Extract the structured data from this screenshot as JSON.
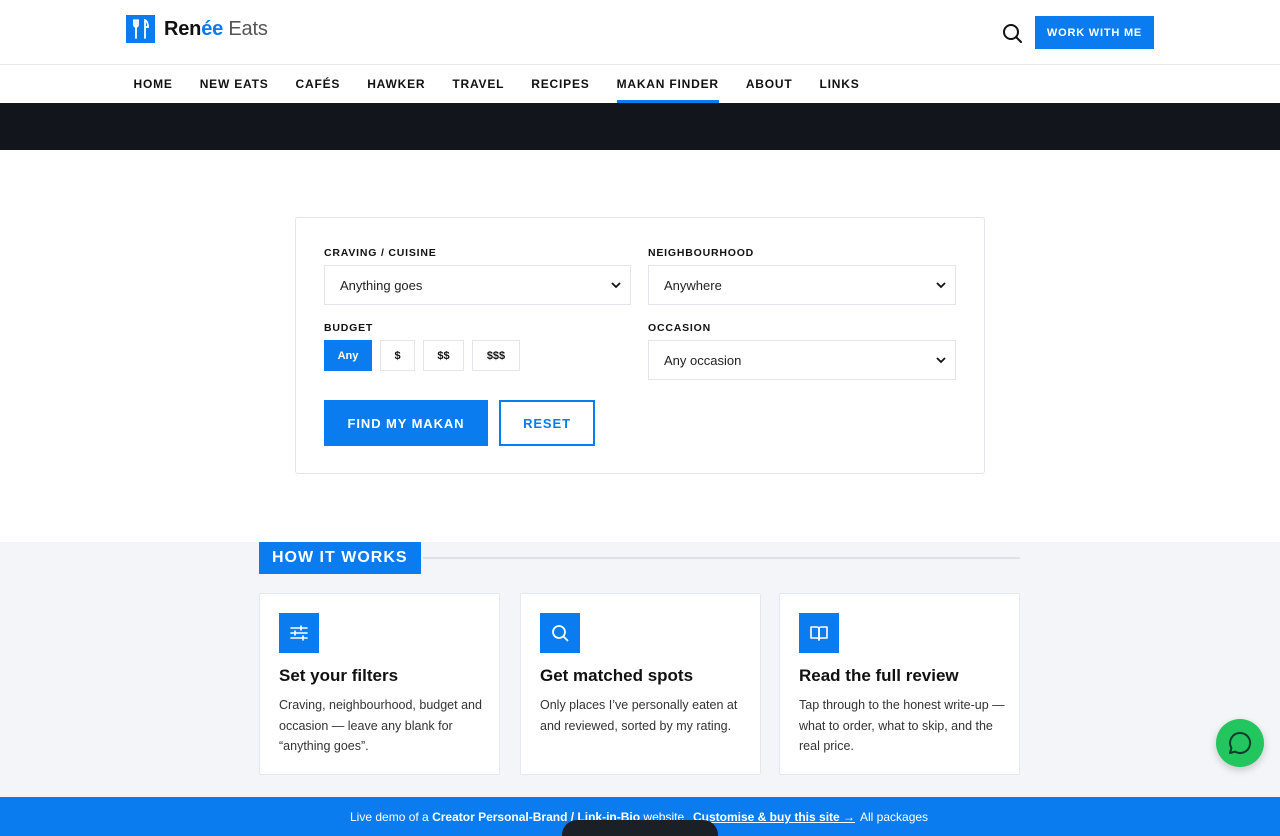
{
  "brand": {
    "name_bold": "Ren",
    "name_accent": "ée",
    "name_light": " Eats"
  },
  "header": {
    "cta_label": "WORK WITH ME"
  },
  "nav": {
    "items": [
      "HOME",
      "NEW EATS",
      "CAFÉS",
      "HAWKER",
      "TRAVEL",
      "RECIPES",
      "MAKAN FINDER",
      "ABOUT",
      "LINKS"
    ],
    "active": "MAKAN FINDER"
  },
  "finder": {
    "craving_label": "CRAVING / CUISINE",
    "craving_value": "Anything goes",
    "neighbourhood_label": "NEIGHBOURHOOD",
    "neighbourhood_value": "Anywhere",
    "budget_label": "BUDGET",
    "budget_options": [
      "Any",
      "$",
      "$$",
      "$$$"
    ],
    "budget_selected": "Any",
    "occasion_label": "OCCASION",
    "occasion_value": "Any occasion",
    "find_label": "FIND MY MAKAN",
    "reset_label": "RESET"
  },
  "how": {
    "title": "HOW IT WORKS",
    "cards": [
      {
        "icon": "sliders-icon",
        "title": "Set your filters",
        "text": "Craving, neighbourhood, budget and occasion — leave any blank for “anything goes”."
      },
      {
        "icon": "search-icon",
        "title": "Get matched spots",
        "text": "Only places I’ve personally eaten at and reviewed, sorted by my rating."
      },
      {
        "icon": "book-icon",
        "title": "Read the full review",
        "text": "Tap through to the honest write-up — what to order, what to skip, and the real price."
      }
    ]
  },
  "banner": {
    "prefix": "Live demo of a ",
    "bold": "Creator Personal-Brand / Link-in-Bio",
    "suffix": " website",
    "customise": "Customise & buy this site →",
    "all": "All packages"
  },
  "colors": {
    "accent": "#0a7cf0",
    "dark_band": "#12161c",
    "chat": "#22c55e"
  }
}
